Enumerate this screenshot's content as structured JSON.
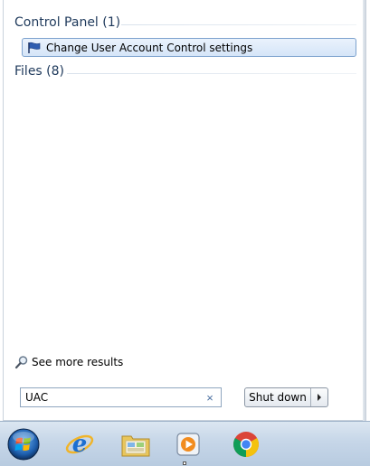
{
  "start_menu": {
    "control_panel_group": {
      "header": "Control Panel (1)",
      "items": [
        {
          "label": "Change User Account Control settings",
          "icon": "uac-flag-icon"
        }
      ]
    },
    "files_group": {
      "header": "Files (8)"
    },
    "see_more": {
      "label": "See more results",
      "icon": "search-icon"
    },
    "search": {
      "value": "UAC",
      "clear_icon": "×"
    },
    "shutdown": {
      "label": "Shut down",
      "arrow_icon": "chevron-right-icon"
    }
  },
  "taskbar": {
    "items": [
      {
        "name": "start-orb",
        "icon": "windows-orb-icon"
      },
      {
        "name": "internet-explorer",
        "icon": "ie-icon"
      },
      {
        "name": "file-explorer",
        "icon": "folder-icon"
      },
      {
        "name": "media-player",
        "icon": "media-player-icon"
      },
      {
        "name": "chrome",
        "icon": "chrome-icon"
      }
    ]
  },
  "colors": {
    "accent": "#1e395b",
    "selection": "#d5e5f8",
    "taskbar": "#c6d6e8"
  }
}
